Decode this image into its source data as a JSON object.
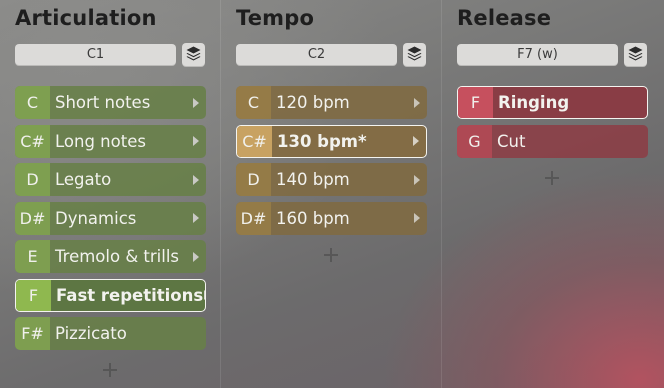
{
  "columns": [
    {
      "title": "Articulation",
      "selector": "C1",
      "rows": [
        {
          "key": "C",
          "label": "Short notes"
        },
        {
          "key": "C#",
          "label": "Long notes"
        },
        {
          "key": "D",
          "label": "Legato"
        },
        {
          "key": "D#",
          "label": "Dynamics"
        },
        {
          "key": "E",
          "label": "Tremolo & trills"
        },
        {
          "key": "F",
          "label": "Fast repetitions",
          "selected": true
        },
        {
          "key": "F#",
          "label": "Pizzicato",
          "no_arrow": true
        }
      ],
      "color": "#8fb84f"
    },
    {
      "title": "Tempo",
      "selector": "C2",
      "rows": [
        {
          "key": "C",
          "label": "120 bpm"
        },
        {
          "key": "C#",
          "label": "130 bpm*",
          "selected": true
        },
        {
          "key": "D",
          "label": "140 bpm"
        },
        {
          "key": "D#",
          "label": "160 bpm"
        }
      ],
      "color": "#c8a262"
    },
    {
      "title": "Release",
      "selector": "F7 (w)",
      "rows": [
        {
          "key": "F",
          "label": "Ringing",
          "selected": true,
          "no_arrow": true
        },
        {
          "key": "G",
          "label": "Cut",
          "no_arrow": true
        }
      ],
      "color": "#c6505e"
    }
  ],
  "icons": {
    "layers": "layers-icon",
    "arrow": "chevron-right-icon",
    "add": "plus-icon"
  }
}
